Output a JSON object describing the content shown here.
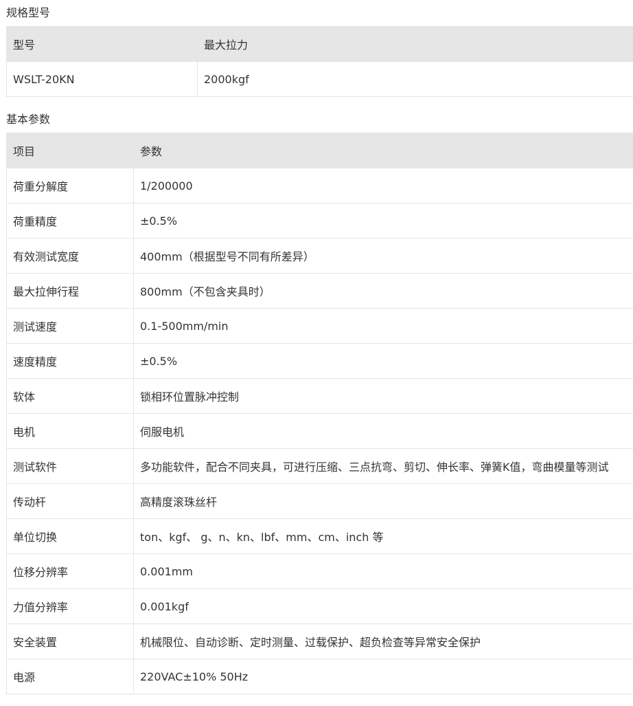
{
  "spec": {
    "title": "规格型号",
    "header": [
      "型号",
      "最大拉力"
    ],
    "rows": [
      [
        "WSLT-20KN",
        "2000kgf"
      ]
    ]
  },
  "params": {
    "title": "基本参数",
    "header": [
      "项目",
      "参数"
    ],
    "rows": [
      [
        "荷重分解度",
        "1/200000"
      ],
      [
        "荷重精度",
        "±0.5%"
      ],
      [
        "有效测试宽度",
        "400mm（根据型号不同有所差异）"
      ],
      [
        "最大拉伸行程",
        "800mm（不包含夹具时）"
      ],
      [
        "测试速度",
        "0.1-500mm/min"
      ],
      [
        "速度精度",
        "±0.5%"
      ],
      [
        "软体",
        "锁相环位置脉冲控制"
      ],
      [
        "电机",
        "伺服电机"
      ],
      [
        "测试软件",
        "多功能软件，配合不同夹具，可进行压缩、三点抗弯、剪切、伸长率、弹簧K值，弯曲模量等测试"
      ],
      [
        "传动杆",
        "高精度滚珠丝杆"
      ],
      [
        "单位切换",
        "ton、kgf、 g、n、kn、lbf、mm、cm、inch 等"
      ],
      [
        "位移分辨率",
        "0.001mm"
      ],
      [
        "力值分辨率",
        "0.001kgf"
      ],
      [
        "安全装置",
        "机械限位、自动诊断、定时测量、过载保护、超负检查等异常安全保护"
      ],
      [
        "电源",
        "220VAC±10% 50Hz"
      ]
    ]
  }
}
